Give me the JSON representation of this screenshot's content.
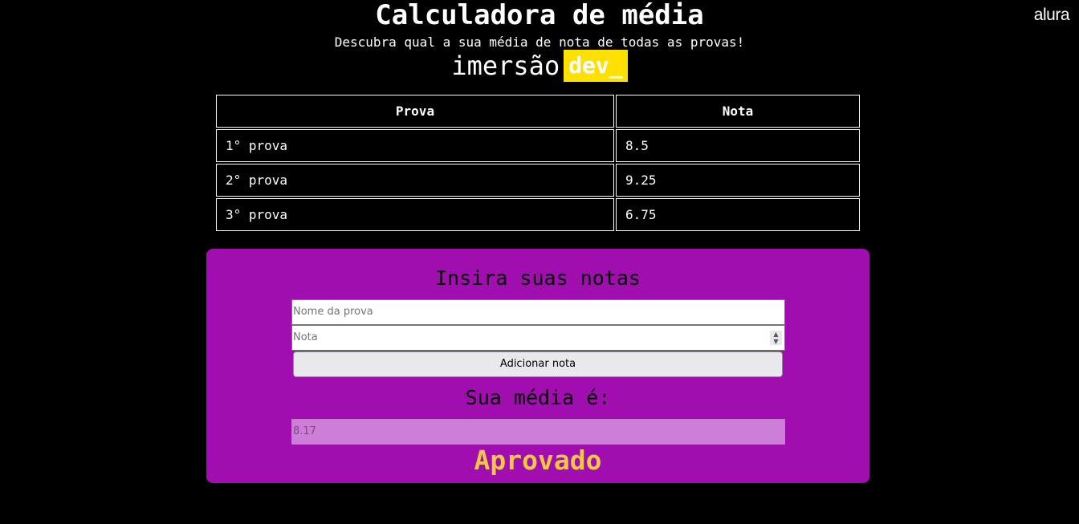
{
  "brand": {
    "name": "alura"
  },
  "header": {
    "title": "Calculadora de média",
    "subtitle": "Descubra qual a sua média de nota de todas as provas!",
    "event_logo": {
      "left": "imersão",
      "right": "dev_",
      "accent_color": "#ffe100"
    }
  },
  "table": {
    "headers": [
      "Prova",
      "Nota"
    ],
    "rows": [
      [
        "1° prova",
        "8.5"
      ],
      [
        "2° prova",
        "9.25"
      ],
      [
        "3° prova",
        "6.75"
      ]
    ]
  },
  "form": {
    "title": "Insira suas notas",
    "name_placeholder": "Nome da prova",
    "note_placeholder": "Nota",
    "add_button": "Adicionar nota",
    "average_label": "Sua média é:",
    "average_value": "8.17",
    "result": "Aprovado",
    "card_color": "#a10eaf",
    "result_color": "#f2c744"
  },
  "icons": {
    "number_spinner": "spinner-arrows-icon"
  }
}
